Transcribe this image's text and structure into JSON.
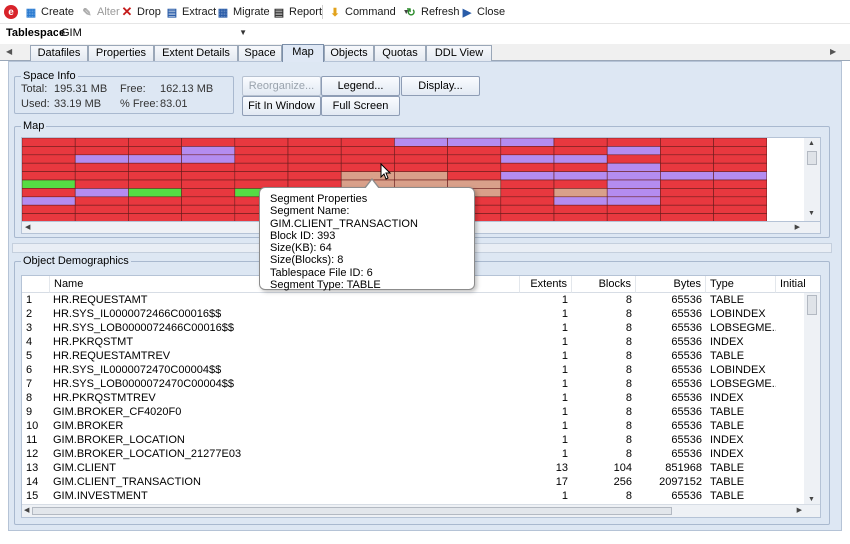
{
  "toolbar": {
    "buttons": [
      {
        "label": "Create",
        "icon": "create-icon",
        "enabled": true
      },
      {
        "label": "Alter",
        "icon": "alter-icon",
        "enabled": false
      },
      {
        "label": "Drop",
        "icon": "drop-icon",
        "enabled": true
      },
      {
        "label": "Extract",
        "icon": "extract-icon",
        "enabled": true
      },
      {
        "label": "Migrate",
        "icon": "migrate-icon",
        "enabled": true
      },
      {
        "label": "Report",
        "icon": "report-icon",
        "enabled": true
      },
      {
        "label": "Command",
        "icon": "command-icon",
        "enabled": true
      },
      {
        "label": "Refresh",
        "icon": "refresh-icon",
        "enabled": true
      },
      {
        "label": "Close",
        "icon": "close-icon",
        "enabled": true
      }
    ]
  },
  "tablespace": {
    "label": "Tablespace",
    "value": "GIM"
  },
  "tabs": [
    "Datafiles",
    "Properties",
    "Extent Details",
    "Space",
    "Map",
    "Objects",
    "Quotas",
    "DDL View"
  ],
  "active_tab": "Map",
  "space_info": {
    "title": "Space Info",
    "total_label": "Total:",
    "total_value": "195.31 MB",
    "used_label": "Used:",
    "used_value": "33.19 MB",
    "free_label": "Free:",
    "free_value": "162.13 MB",
    "pctfree_label": "% Free:",
    "pctfree_value": "83.01"
  },
  "buttons": {
    "reorganize": "Reorganize...",
    "legend": "Legend...",
    "display": "Display...",
    "fit_in_window": "Fit In Window",
    "full_screen": "Full Screen"
  },
  "map": {
    "title": "Map",
    "colors": {
      "table": "#e8383f",
      "index": "#b48cf0",
      "lob": "#55dd44",
      "other": "#d9a08a"
    }
  },
  "tooltip": {
    "title": "Segment Properties",
    "lines": [
      "Segment Name: GIM.CLIENT_TRANSACTION",
      "Block ID: 393",
      "Size(KB): 64",
      "Size(Blocks): 8",
      "Tablespace File ID: 6",
      "Segment Type: TABLE"
    ]
  },
  "demographics": {
    "title": "Object Demographics",
    "columns": [
      "Name",
      "Extents",
      "Blocks",
      "Bytes",
      "Type",
      "Initial"
    ],
    "rows": [
      [
        "1",
        "HR.REQUESTAMT",
        "1",
        "8",
        "65536",
        "TABLE"
      ],
      [
        "2",
        "HR.SYS_IL0000072466C00016$$",
        "1",
        "8",
        "65536",
        "LOBINDEX"
      ],
      [
        "3",
        "HR.SYS_LOB0000072466C00016$$",
        "1",
        "8",
        "65536",
        "LOBSEGME..."
      ],
      [
        "4",
        "HR.PKRQSTMT",
        "1",
        "8",
        "65536",
        "INDEX"
      ],
      [
        "5",
        "HR.REQUESTAMTREV",
        "1",
        "8",
        "65536",
        "TABLE"
      ],
      [
        "6",
        "HR.SYS_IL0000072470C00004$$",
        "1",
        "8",
        "65536",
        "LOBINDEX"
      ],
      [
        "7",
        "HR.SYS_LOB0000072470C00004$$",
        "1",
        "8",
        "65536",
        "LOBSEGME..."
      ],
      [
        "8",
        "HR.PKRQSTMTREV",
        "1",
        "8",
        "65536",
        "INDEX"
      ],
      [
        "9",
        "GIM.BROKER_CF4020F0",
        "1",
        "8",
        "65536",
        "TABLE"
      ],
      [
        "10",
        "GIM.BROKER",
        "1",
        "8",
        "65536",
        "TABLE"
      ],
      [
        "11",
        "GIM.BROKER_LOCATION",
        "1",
        "8",
        "65536",
        "INDEX"
      ],
      [
        "12",
        "GIM.BROKER_LOCATION_21277E03",
        "1",
        "8",
        "65536",
        "INDEX"
      ],
      [
        "13",
        "GIM.CLIENT",
        "13",
        "104",
        "851968",
        "TABLE"
      ],
      [
        "14",
        "GIM.CLIENT_TRANSACTION",
        "17",
        "256",
        "2097152",
        "TABLE"
      ],
      [
        "15",
        "GIM.INVESTMENT",
        "1",
        "8",
        "65536",
        "TABLE"
      ]
    ]
  }
}
